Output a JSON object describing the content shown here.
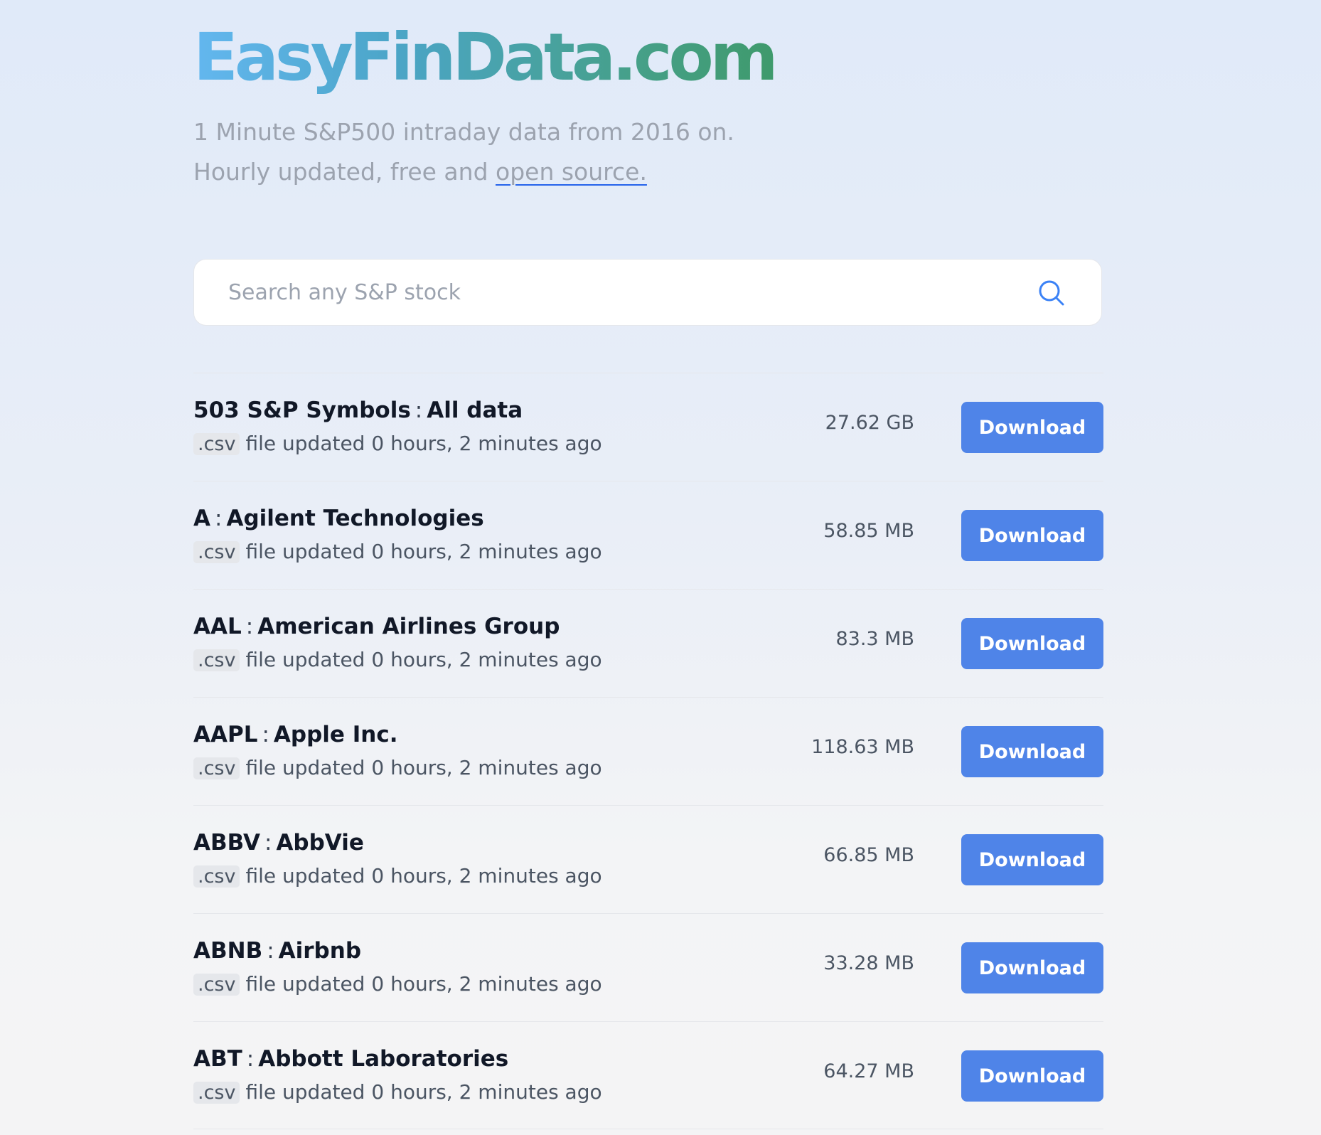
{
  "header": {
    "logo": "EasyFinData.com",
    "tagline_line1": "1 Minute S&P500 intraday data from 2016 on.",
    "tagline_line2_prefix": "Hourly updated, free and ",
    "tagline_link": "open source."
  },
  "search": {
    "placeholder": "Search any S&P stock",
    "value": "",
    "icon": "search-icon"
  },
  "list": {
    "separator": ":",
    "ext": ".csv",
    "button_label": "Download",
    "items": [
      {
        "symbol": "503 S&P Symbols",
        "name": "All data",
        "meta": "file updated 0 hours, 2 minutes ago",
        "size": "27.62 GB"
      },
      {
        "symbol": "A",
        "name": "Agilent Technologies",
        "meta": "file updated 0 hours, 2 minutes ago",
        "size": "58.85 MB"
      },
      {
        "symbol": "AAL",
        "name": "American Airlines Group",
        "meta": "file updated 0 hours, 2 minutes ago",
        "size": "83.3 MB"
      },
      {
        "symbol": "AAPL",
        "name": "Apple Inc.",
        "meta": "file updated 0 hours, 2 minutes ago",
        "size": "118.63 MB"
      },
      {
        "symbol": "ABBV",
        "name": "AbbVie",
        "meta": "file updated 0 hours, 2 minutes ago",
        "size": "66.85 MB"
      },
      {
        "symbol": "ABNB",
        "name": "Airbnb",
        "meta": "file updated 0 hours, 2 minutes ago",
        "size": "33.28 MB"
      },
      {
        "symbol": "ABT",
        "name": "Abbott Laboratories",
        "meta": "file updated 0 hours, 2 minutes ago",
        "size": "64.27 MB"
      }
    ]
  },
  "colors": {
    "accent": "#4f84e8",
    "logo_start": "#63b7ef",
    "logo_end": "#3f9a6c",
    "link_underline": "#2563eb"
  }
}
